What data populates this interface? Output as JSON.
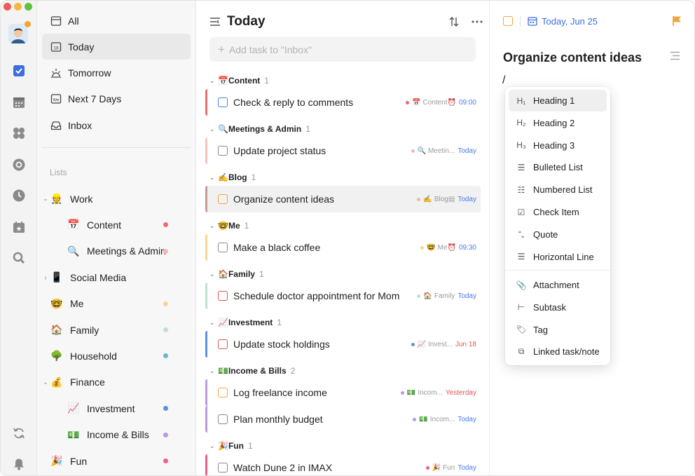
{
  "window": {
    "traffic": [
      "#ee5c57",
      "#f4b73f",
      "#5dc23f"
    ]
  },
  "rail": {
    "icons": [
      {
        "name": "task-checkbox-icon",
        "color": "#3d6de0"
      },
      {
        "name": "calendar-icon",
        "color": "#8a8a8a"
      },
      {
        "name": "grid-icon",
        "color": "#8a8a8a"
      },
      {
        "name": "habit-icon",
        "color": "#8a8a8a"
      },
      {
        "name": "clock-icon",
        "color": "#8a8a8a"
      },
      {
        "name": "countdown-icon",
        "color": "#8a8a8a"
      },
      {
        "name": "search-icon",
        "color": "#8a8a8a"
      },
      {
        "name": "sync-icon",
        "color": "#8a8a8a"
      },
      {
        "name": "bell-icon",
        "color": "#8a8a8a"
      }
    ]
  },
  "sidebar": {
    "smart_lists": [
      {
        "label": "All",
        "icon": "inbox-tray-icon"
      },
      {
        "label": "Today",
        "icon": "calendar-16-icon",
        "day": "16",
        "active": true
      },
      {
        "label": "Tomorrow",
        "icon": "sunrise-icon"
      },
      {
        "label": "Next 7 Days",
        "icon": "week-calendar-icon",
        "day": "We"
      },
      {
        "label": "Inbox",
        "icon": "inbox-icon"
      }
    ],
    "lists_label": "Lists",
    "lists": [
      {
        "label": "Work",
        "emoji": "👷",
        "chevron": "⌄",
        "indent": 0,
        "dot": ""
      },
      {
        "label": "Content",
        "emoji": "📅",
        "chevron": "",
        "indent": 1,
        "dot": "#ee6b6b"
      },
      {
        "label": "Meetings & Admin",
        "emoji": "🔍",
        "chevron": "",
        "indent": 1,
        "dot": "#f4b8b0"
      },
      {
        "label": "Social Media",
        "emoji": "📱",
        "chevron": "›",
        "indent": 0,
        "dot": ""
      },
      {
        "label": "Me",
        "emoji": "🤓",
        "chevron": "",
        "indent": 0,
        "dot": "#f7d78f"
      },
      {
        "label": "Family",
        "emoji": "🏠",
        "chevron": "",
        "indent": 0,
        "dot": "#bfe0cf"
      },
      {
        "label": "Household",
        "emoji": "🌳",
        "chevron": "",
        "indent": 0,
        "dot": "#6fb3d1"
      },
      {
        "label": "Finance",
        "emoji": "💰",
        "chevron": "⌄",
        "indent": 0,
        "dot": ""
      },
      {
        "label": "Investment",
        "emoji": "📈",
        "chevron": "",
        "indent": 1,
        "dot": "#5b8fe0"
      },
      {
        "label": "Income & Bills",
        "emoji": "💵",
        "chevron": "",
        "indent": 1,
        "dot": "#b79ae0"
      },
      {
        "label": "Fun",
        "emoji": "🎉",
        "chevron": "",
        "indent": 0,
        "dot": "#ee5e8a"
      }
    ]
  },
  "main": {
    "title": "Today",
    "add_placeholder": "Add task to \"Inbox\"",
    "groups": [
      {
        "emoji": "📅",
        "name": "Content",
        "count": "1",
        "tasks": [
          {
            "title": "Check & reply to comments",
            "bar": "#ee6b6b",
            "cb": "#4a7bea",
            "dot": "#ee6b6b",
            "emoji": "📅",
            "list": "Content",
            "time": "09:00",
            "time_color": "#4a7bea",
            "alarm": true
          }
        ]
      },
      {
        "emoji": "🔍",
        "name": "Meetings & Admin",
        "count": "1",
        "tasks": [
          {
            "title": "Update project status",
            "bar": "#f4c4bc",
            "cb": "#888888",
            "dot": "#f4b8b0",
            "emoji": "🔍",
            "list": "Meetin...",
            "time": "Today",
            "time_color": "#4a7bea",
            "alarm": false
          }
        ]
      },
      {
        "emoji": "✍️",
        "name": "Blog",
        "count": "1",
        "tasks": [
          {
            "title": "Organize content ideas",
            "bar": "#c79b96",
            "cb": "#f0a640",
            "dot": "#f4b8b0",
            "emoji": "✍️",
            "list": "Blog",
            "time": "Today",
            "time_color": "#4a7bea",
            "alarm": false,
            "note": true,
            "selected": true
          }
        ]
      },
      {
        "emoji": "🤓",
        "name": "Me",
        "count": "1",
        "tasks": [
          {
            "title": "Make a black coffee",
            "bar": "#f7d78f",
            "cb": "#888888",
            "dot": "#f7d78f",
            "emoji": "🤓",
            "list": "Me",
            "time": "09:30",
            "time_color": "#4a7bea",
            "alarm": true
          }
        ]
      },
      {
        "emoji": "🏠",
        "name": "Family",
        "count": "1",
        "tasks": [
          {
            "title": "Schedule doctor appointment for Mom",
            "bar": "#bfe0cf",
            "cb": "#e05555",
            "dot": "#bfe0cf",
            "emoji": "🏠",
            "list": "Family",
            "time": "Today",
            "time_color": "#4a7bea",
            "alarm": false
          }
        ]
      },
      {
        "emoji": "📈",
        "name": "Investment",
        "count": "1",
        "tasks": [
          {
            "title": "Update stock holdings",
            "bar": "#5b8fe0",
            "cb": "#e05555",
            "dot": "#5b8fe0",
            "emoji": "📈",
            "list": "Invest...",
            "time": "Jun 18",
            "time_color": "#e05555",
            "alarm": false
          }
        ]
      },
      {
        "emoji": "💵",
        "name": "Income & Bills",
        "count": "2",
        "tasks": [
          {
            "title": "Log freelance income",
            "bar": "#b79ae0",
            "cb": "#f0a640",
            "dot": "#b79ae0",
            "emoji": "💵",
            "list": "Incom...",
            "time": "Yesterday",
            "time_color": "#e05555",
            "alarm": false
          },
          {
            "title": "Plan monthly budget",
            "bar": "#b79ae0",
            "cb": "#888888",
            "dot": "#b79ae0",
            "emoji": "💵",
            "list": "Incom...",
            "time": "Today",
            "time_color": "#4a7bea",
            "alarm": false
          }
        ]
      },
      {
        "emoji": "🎉",
        "name": "Fun",
        "count": "1",
        "tasks": [
          {
            "title": "Watch Dune 2 in IMAX",
            "bar": "#ee5e8a",
            "cb": "#888888",
            "dot": "#ee5e8a",
            "emoji": "🎉",
            "list": "Fun",
            "time": "Today",
            "time_color": "#4a7bea",
            "alarm": false
          }
        ]
      }
    ]
  },
  "detail": {
    "date": "Today, Jun 25",
    "title": "Organize content ideas",
    "slash": "/",
    "flag_color": "#f0a640",
    "menu": [
      {
        "label": "Heading 1",
        "icon": "H₁",
        "icon_name": "heading-1-icon",
        "hover": true
      },
      {
        "label": "Heading 2",
        "icon": "H₂",
        "icon_name": "heading-2-icon"
      },
      {
        "label": "Heading 3",
        "icon": "H₃",
        "icon_name": "heading-3-icon"
      },
      {
        "label": "Bulleted List",
        "icon": "☰",
        "icon_name": "bulleted-list-icon"
      },
      {
        "label": "Numbered List",
        "icon": "☷",
        "icon_name": "numbered-list-icon"
      },
      {
        "label": "Check Item",
        "icon": "☑",
        "icon_name": "check-item-icon"
      },
      {
        "label": "Quote",
        "icon": "“„",
        "icon_name": "quote-icon"
      },
      {
        "label": "Horizontal Line",
        "icon": "☰",
        "icon_name": "horizontal-line-icon"
      },
      {
        "label": "Attachment",
        "icon": "📎",
        "icon_name": "paperclip-icon"
      },
      {
        "label": "Subtask",
        "icon": "⊢",
        "icon_name": "subtask-icon"
      },
      {
        "label": "Tag",
        "icon": "🏷",
        "icon_name": "tag-icon"
      },
      {
        "label": "Linked task/note",
        "icon": "⧉",
        "icon_name": "linked-note-icon"
      }
    ]
  }
}
